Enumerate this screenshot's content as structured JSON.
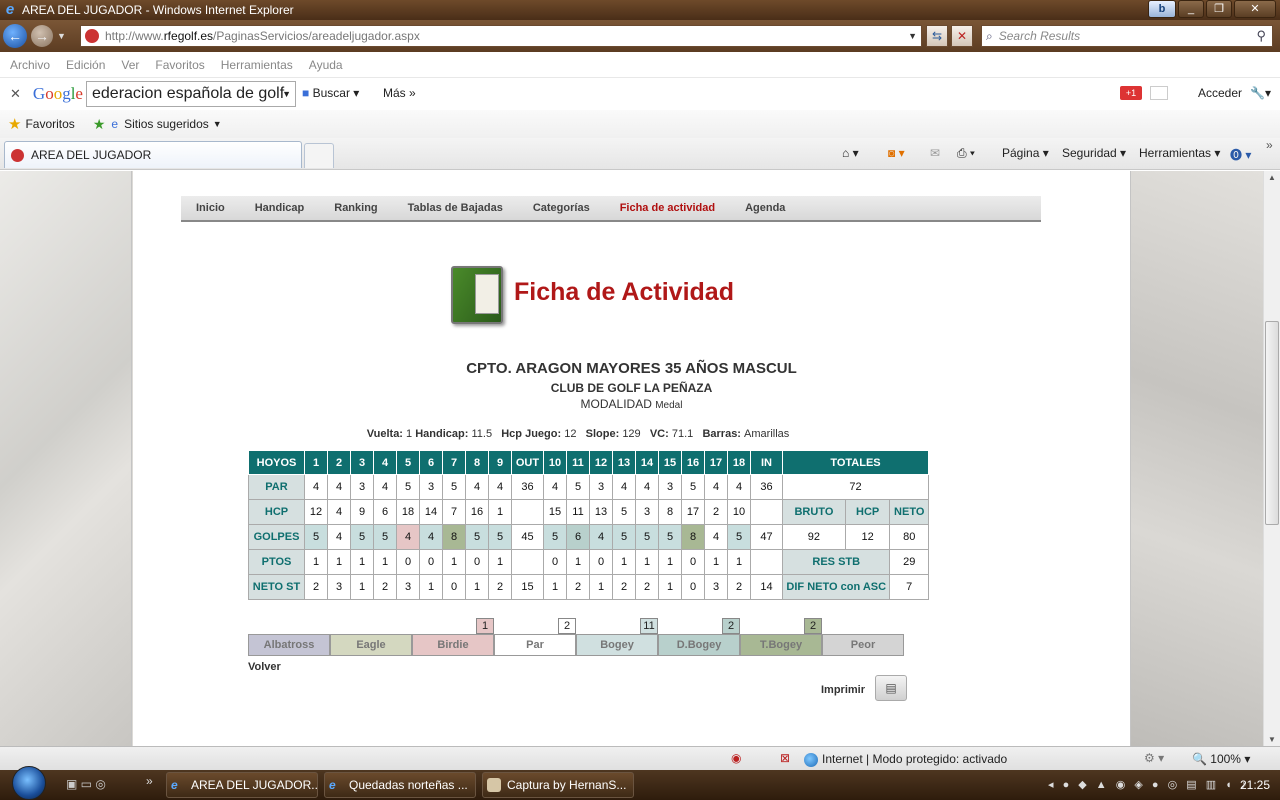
{
  "window": {
    "title": "AREA DEL JUGADOR - Windows Internet Explorer"
  },
  "address": {
    "url_prefix": "http://www.",
    "url_domain": "rfegolf.es",
    "url_path": "/PaginasServicios/areadeljugador.aspx"
  },
  "search": {
    "placeholder": "Search Results"
  },
  "menu": [
    "Archivo",
    "Edición",
    "Ver",
    "Favoritos",
    "Herramientas",
    "Ayuda"
  ],
  "google": {
    "logo": "Google",
    "query": "ederacion española de golf",
    "buscar": "Buscar",
    "mas": "Más",
    "gplus": "+1",
    "acceder": "Acceder"
  },
  "favbar": {
    "favoritos": "Favoritos",
    "sitios": "Sitios sugeridos"
  },
  "tab": {
    "title": "AREA DEL JUGADOR"
  },
  "commandbar": {
    "pagina": "Página",
    "seguridad": "Seguridad",
    "herramientas": "Herramientas"
  },
  "sitenav": [
    "Inicio",
    "Handicap",
    "Ranking",
    "Tablas de Bajadas",
    "Categorías",
    "Ficha de actividad",
    "Agenda"
  ],
  "page": {
    "title": "Ficha de Actividad",
    "competition": "CPTO. ARAGON MAYORES 35 AÑOS MASCUL",
    "club": "CLUB DE GOLF LA PEÑAZA",
    "modalidad_label": "MODALIDAD",
    "modalidad_value": "Medal",
    "info": {
      "vuelta_label": "Vuelta:",
      "vuelta": "1",
      "handicap_label": "Handicap:",
      "handicap": "11.5",
      "hcp_juego_label": "Hcp Juego:",
      "hcp_juego": "12",
      "slope_label": "Slope:",
      "slope": "129",
      "vc_label": "VC:",
      "vc": "71.1",
      "barras_label": "Barras:",
      "barras": "Amarillas"
    }
  },
  "scorecard": {
    "header_label": "HOYOS",
    "holes": [
      "1",
      "2",
      "3",
      "4",
      "5",
      "6",
      "7",
      "8",
      "9",
      "OUT",
      "10",
      "11",
      "12",
      "13",
      "14",
      "15",
      "16",
      "17",
      "18",
      "IN"
    ],
    "totales_label": "TOTALES",
    "rows": [
      {
        "label": "PAR",
        "values": [
          "4",
          "4",
          "3",
          "4",
          "5",
          "3",
          "5",
          "4",
          "4",
          "36",
          "4",
          "5",
          "3",
          "4",
          "4",
          "3",
          "5",
          "4",
          "4",
          "36"
        ],
        "totals": [
          "72"
        ]
      },
      {
        "label": "HCP",
        "values": [
          "12",
          "4",
          "9",
          "6",
          "18",
          "14",
          "7",
          "16",
          "1",
          "",
          "15",
          "11",
          "13",
          "5",
          "3",
          "8",
          "17",
          "2",
          "10",
          ""
        ],
        "totals": [
          "BRUTO",
          "HCP",
          "NETO"
        ]
      },
      {
        "label": "GOLPES",
        "values": [
          "5",
          "4",
          "5",
          "5",
          "4",
          "4",
          "8",
          "5",
          "5",
          "45",
          "5",
          "6",
          "4",
          "5",
          "5",
          "5",
          "8",
          "4",
          "5",
          "47"
        ],
        "totals": [
          "92",
          "12",
          "80"
        ]
      },
      {
        "label": "PTOS",
        "values": [
          "1",
          "1",
          "1",
          "1",
          "0",
          "0",
          "1",
          "0",
          "1",
          "",
          "0",
          "1",
          "0",
          "1",
          "1",
          "1",
          "0",
          "1",
          "1",
          ""
        ],
        "totals": [
          "RES STB",
          "29"
        ]
      },
      {
        "label": "NETO ST",
        "values": [
          "2",
          "3",
          "1",
          "2",
          "3",
          "1",
          "0",
          "1",
          "2",
          "15",
          "1",
          "2",
          "1",
          "2",
          "2",
          "1",
          "0",
          "3",
          "2",
          "14"
        ],
        "totals": [
          "DIF NETO con ASC",
          "7"
        ]
      }
    ],
    "golpes_classes": [
      "bogey",
      "par",
      "bogey",
      "bogey",
      "birdie",
      "bogey",
      "tbogey",
      "bogey",
      "bogey",
      "par",
      "bogey",
      "dbogey",
      "bogey",
      "bogey",
      "bogey",
      "bogey",
      "tbogey",
      "par",
      "bogey",
      "par"
    ]
  },
  "legend": {
    "items": [
      "Albatross",
      "Eagle",
      "Birdie",
      "Par",
      "Bogey",
      "D.Bogey",
      "T.Bogey",
      "Peor"
    ],
    "counts": [
      "1",
      "2",
      "11",
      "2",
      "2"
    ]
  },
  "volver": "Volver",
  "imprimir": "Imprimir",
  "status": {
    "zone": "Internet | Modo protegido: activado",
    "zoom": "100%"
  },
  "taskbar": {
    "items": [
      "AREA DEL JUGADOR...",
      "Quedadas norteñas ...",
      "Captura by HernanS..."
    ],
    "clock": "21:25"
  },
  "colors": {
    "accent": "#0f6f6f",
    "title_red": "#b01818",
    "nav_active": "#b01010"
  }
}
